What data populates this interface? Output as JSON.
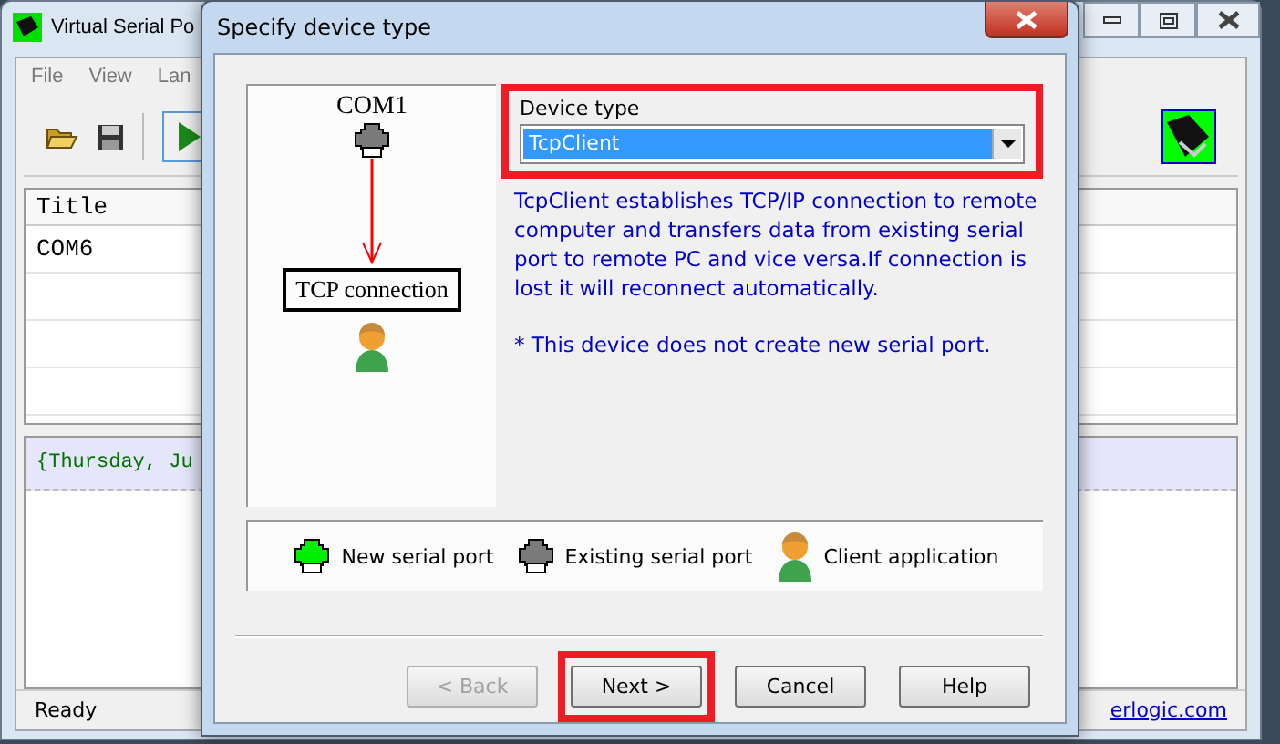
{
  "background_window": {
    "title": "Virtual Serial Po",
    "menu": [
      "File",
      "View",
      "Lan"
    ],
    "table": {
      "columns": [
        "Title"
      ],
      "rows": [
        "COM6"
      ]
    },
    "log": [
      "{Thursday, Ju"
    ],
    "status_bar": {
      "text": "Ready",
      "link": "erlogic.com"
    }
  },
  "dialog": {
    "title": "Specify device type",
    "diagram": {
      "port_label": "COM1",
      "connection_label": "TCP connection"
    },
    "device_type": {
      "label": "Device type",
      "value": "TcpClient",
      "highlighted": true
    },
    "description": "TcpClient establishes TCP/IP connection to remote computer and transfers data from existing serial port to remote PC and vice versa.If connection is lost it will reconnect automatically.",
    "note": "* This device does not create new serial port.",
    "legend": [
      {
        "kind": "new_port",
        "label": "New serial port"
      },
      {
        "kind": "existing_port",
        "label": "Existing serial port"
      },
      {
        "kind": "client",
        "label": "Client application"
      }
    ],
    "buttons": [
      {
        "label": "< Back",
        "disabled": true,
        "highlighted": false
      },
      {
        "label": "Next >",
        "disabled": false,
        "highlighted": true
      },
      {
        "label": "Cancel",
        "disabled": false,
        "highlighted": false
      },
      {
        "label": "Help",
        "disabled": false,
        "highlighted": false
      }
    ]
  }
}
